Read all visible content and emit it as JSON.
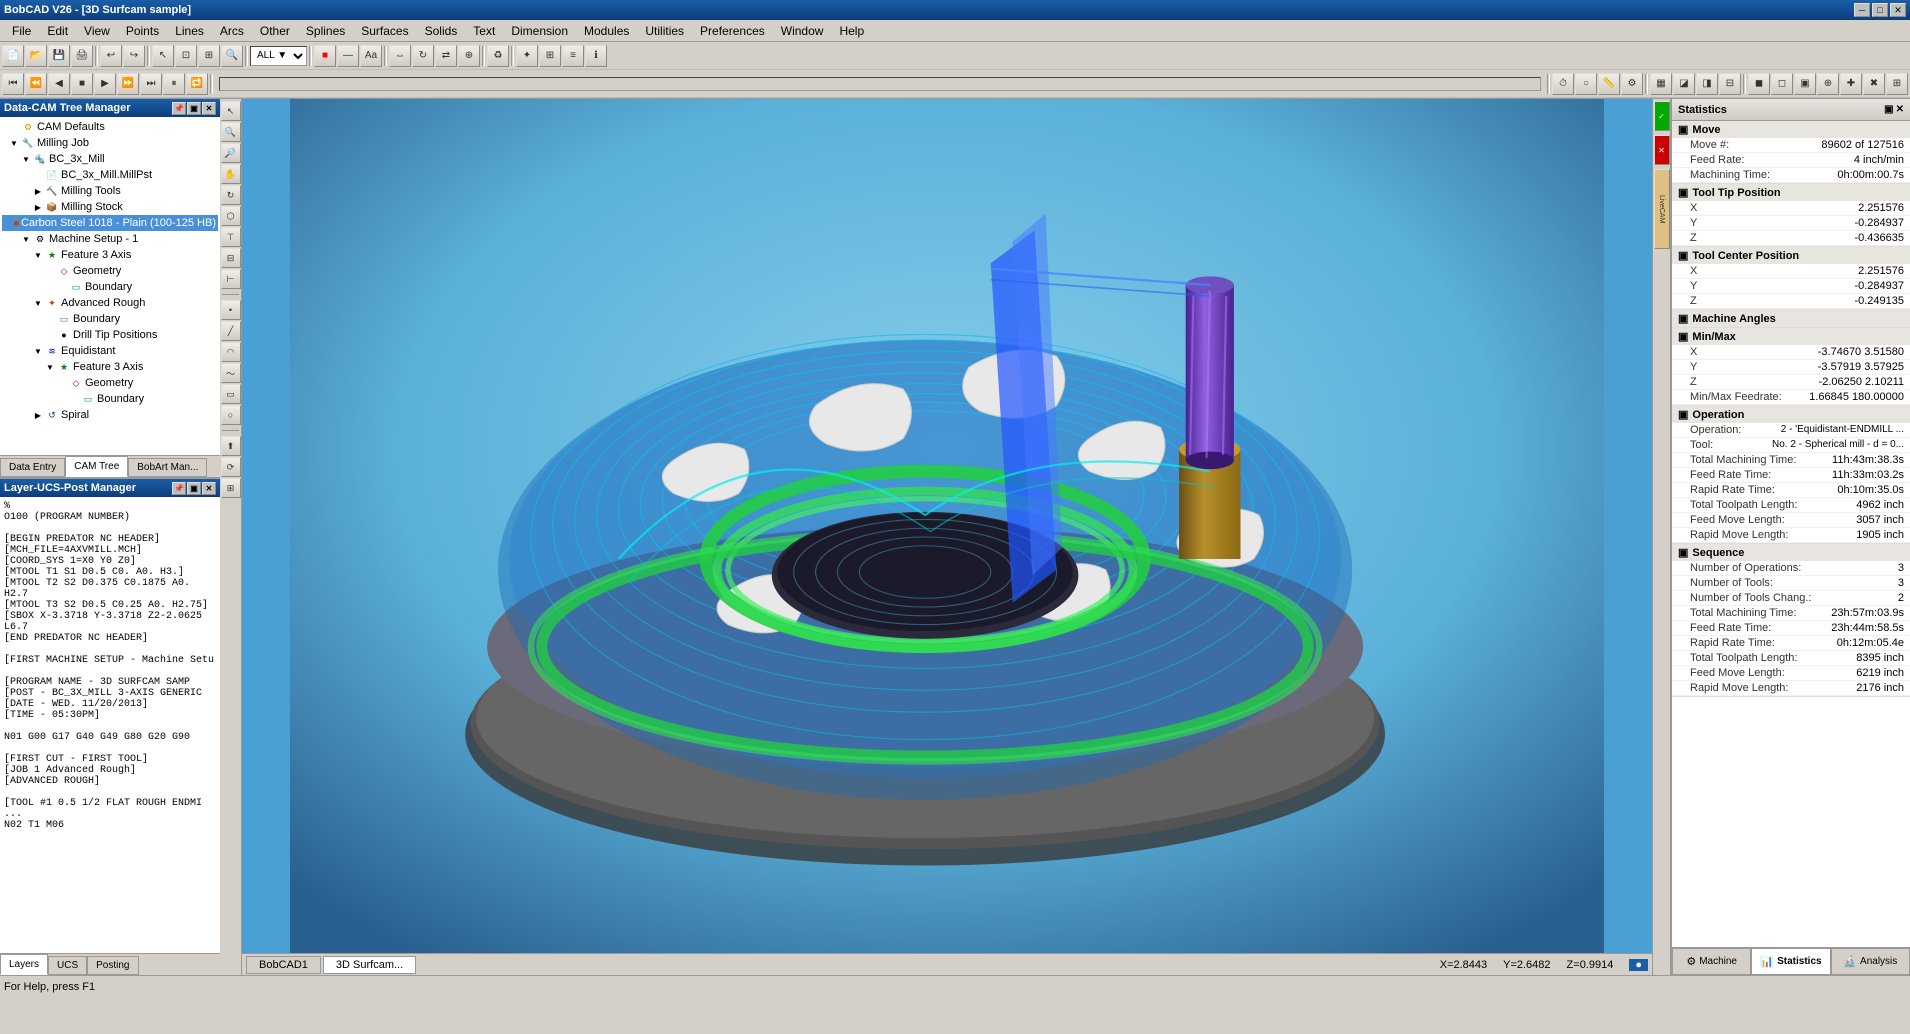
{
  "window": {
    "title": "BobCAD V26 - [3D Surfcam sample]",
    "minimize": "─",
    "maximize": "□",
    "close": "✕"
  },
  "menu": {
    "items": [
      "File",
      "Edit",
      "View",
      "Points",
      "Lines",
      "Arcs",
      "Other",
      "Splines",
      "Surfaces",
      "Solids",
      "Text",
      "Dimension",
      "Modules",
      "Utilities",
      "Preferences",
      "Window",
      "Help"
    ]
  },
  "cam_tree": {
    "title": "Data-CAM Tree Manager",
    "items": [
      {
        "label": "CAM Defaults",
        "indent": 0,
        "icon": "⚙",
        "expander": ""
      },
      {
        "label": "Milling Job",
        "indent": 0,
        "icon": "🔧",
        "expander": "▼"
      },
      {
        "label": "BC_3x_Mill",
        "indent": 1,
        "icon": "🔩",
        "expander": "▼"
      },
      {
        "label": "BC_3x_Mill.MillPst",
        "indent": 2,
        "icon": "📄",
        "expander": ""
      },
      {
        "label": "Milling Tools",
        "indent": 2,
        "icon": "🔨",
        "expander": "▶"
      },
      {
        "label": "Milling Stock",
        "indent": 2,
        "icon": "📦",
        "expander": "▶"
      },
      {
        "label": "Carbon Steel 1018 - Plain (100-125 HB)",
        "indent": 3,
        "icon": "■",
        "expander": "",
        "selected": true
      },
      {
        "label": "Machine Setup - 1",
        "indent": 1,
        "icon": "⚙",
        "expander": "▼"
      },
      {
        "label": "Feature 3 Axis",
        "indent": 2,
        "icon": "★",
        "expander": "▼"
      },
      {
        "label": "Geometry",
        "indent": 3,
        "icon": "◇",
        "expander": ""
      },
      {
        "label": "Boundary",
        "indent": 3,
        "icon": "▭",
        "expander": ""
      },
      {
        "label": "Advanced Rough",
        "indent": 2,
        "icon": "✦",
        "expander": "▼"
      },
      {
        "label": "Boundary",
        "indent": 3,
        "icon": "▭",
        "expander": ""
      },
      {
        "label": "Drill Tip Positions",
        "indent": 3,
        "icon": "●",
        "expander": ""
      },
      {
        "label": "Equidistant",
        "indent": 2,
        "icon": "≋",
        "expander": "▼"
      },
      {
        "label": "Feature 3 Axis",
        "indent": 3,
        "icon": "★",
        "expander": "▼"
      },
      {
        "label": "Geometry",
        "indent": 4,
        "icon": "◇",
        "expander": ""
      },
      {
        "label": "Boundary",
        "indent": 4,
        "icon": "▭",
        "expander": ""
      },
      {
        "label": "Spiral",
        "indent": 2,
        "icon": "↺",
        "expander": "▶"
      }
    ],
    "tabs": [
      "Data Entry",
      "CAM Tree",
      "BobArt Man..."
    ]
  },
  "layer_ucs_panel": {
    "title": "Layer-UCS-Post Manager",
    "content_lines": [
      "%",
      "O100 (PROGRAM NUMBER)",
      "",
      "[BEGIN PREDATOR NC HEADER]",
      "[MCH_FILE=4AXVMILL.MCH]",
      "[COORD_SYS 1=X0 Y0 Z0]",
      "[MTOOL T1 S1 D0.5 C0. A0. H3.]",
      "[MTOOL T2 S2 D0.375 C0.1875 A0. H2.7",
      "[MTOOL T3 S2 D0.5 C0.25 A0. H2.75]",
      "[SBOX X-3.3718 Y-3.3718 Z2-2.0625 L6.7",
      "[END PREDATOR NC HEADER]",
      "",
      "[FIRST MACHINE SETUP - Machine Setu",
      "",
      "[PROGRAM NAME - 3D SURFCAM SAMP",
      "[POST - BC_3X_MILL 3-AXIS GENERIC",
      "[DATE - WED. 11/20/2013]",
      "[TIME - 05:30PM]",
      "",
      "N01 G00 G17 G40 G49 G80 G20 G90",
      "",
      "[FIRST CUT - FIRST TOOL]",
      "[JOB 1  Advanced Rough]",
      "[ADVANCED ROUGH]",
      "",
      "[TOOL #1 0.5  1/2 FLAT ROUGH ENDMI ...",
      "N02 T1 M06"
    ],
    "tabs": [
      "Layers",
      "UCS",
      "Posting"
    ]
  },
  "viewport": {
    "tabs": [
      "BobCAD1",
      "3D Surfcam..."
    ],
    "active_tab": "3D Surfcam...",
    "coords": {
      "x_label": "X=",
      "x_value": "2.8443",
      "y_label": "Y=",
      "y_value": "2.6482",
      "z_label": "Z=",
      "z_value": "0.9914"
    }
  },
  "statistics": {
    "title": "Statistics",
    "close_btn": "✕",
    "float_btn": "▣",
    "sections": {
      "move": {
        "label": "Move",
        "expanded": true,
        "rows": [
          {
            "label": "Move #:",
            "value": "89602 of 127516"
          },
          {
            "label": "Feed Rate:",
            "value": "4 inch/min"
          },
          {
            "label": "Machining Time:",
            "value": "0h:00m:00.7s"
          }
        ]
      },
      "tool_tip_position": {
        "label": "Tool Tip Position",
        "expanded": true,
        "rows": [
          {
            "label": "X",
            "value": "2.251576"
          },
          {
            "label": "Y",
            "value": "-0.284937"
          },
          {
            "label": "Z",
            "value": "-0.436635"
          }
        ]
      },
      "tool_center_position": {
        "label": "Tool Center Position",
        "expanded": true,
        "rows": [
          {
            "label": "X",
            "value": "2.251576"
          },
          {
            "label": "Y",
            "value": "-0.284937"
          },
          {
            "label": "Z",
            "value": "-0.249135"
          }
        ]
      },
      "machine_angles": {
        "label": "Machine Angles",
        "expanded": true,
        "rows": []
      },
      "min_max": {
        "label": "Min/Max",
        "expanded": true,
        "rows": [
          {
            "label": "X",
            "value": "-3.74670   3.51580"
          },
          {
            "label": "Y",
            "value": "-3.57919   3.57925"
          },
          {
            "label": "Z",
            "value": "-2.06250   2.10211"
          },
          {
            "label": "Min/Max Feedrate:",
            "value": "1.66845   180.00000"
          }
        ]
      },
      "operation": {
        "label": "Operation",
        "expanded": true,
        "rows": [
          {
            "label": "Operation:",
            "value": "2 - 'Equidistant-ENDMILL ..."
          },
          {
            "label": "Tool:",
            "value": "No. 2 - Spherical mill - d = 0..."
          },
          {
            "label": "Total Machining Time:",
            "value": "11h:43m:38.3s"
          },
          {
            "label": "Feed Rate Time:",
            "value": "11h:33m:03.2s"
          },
          {
            "label": "Rapid Rate Time:",
            "value": "0h:10m:35.0s"
          },
          {
            "label": "Total Toolpath Length:",
            "value": "4962 inch"
          },
          {
            "label": "Feed Move Length:",
            "value": "3057 inch"
          },
          {
            "label": "Rapid Move Length:",
            "value": "1905 inch"
          }
        ]
      },
      "sequence": {
        "label": "Sequence",
        "expanded": true,
        "rows": [
          {
            "label": "Number of Operations:",
            "value": "3"
          },
          {
            "label": "Number of Tools:",
            "value": "3"
          },
          {
            "label": "Number of Tools Chang.:",
            "value": "2"
          },
          {
            "label": "Total Machining Time:",
            "value": "23h:57m:03.9s"
          },
          {
            "label": "Feed Rate Time:",
            "value": "23h:44m:58.5s"
          },
          {
            "label": "Rapid Rate Time:",
            "value": "0h:12m:05.4e"
          },
          {
            "label": "Total Toolpath Length:",
            "value": "8395 inch"
          },
          {
            "label": "Feed Move Length:",
            "value": "6219 inch"
          },
          {
            "label": "Rapid Move Length:",
            "value": "2176 inch"
          }
        ]
      }
    },
    "tabs": [
      "Machine",
      "Statistics",
      "Analysis"
    ],
    "active_tab": "Statistics"
  },
  "status_bar": {
    "help_text": "For Help, press F1"
  },
  "colors": {
    "title_bar_start": "#1a5fa8",
    "title_bar_end": "#0d3d7a",
    "panel_bg": "#d4d0c8",
    "viewport_bg": "#4a9fd4",
    "selected_item": "#4a7fd4"
  }
}
